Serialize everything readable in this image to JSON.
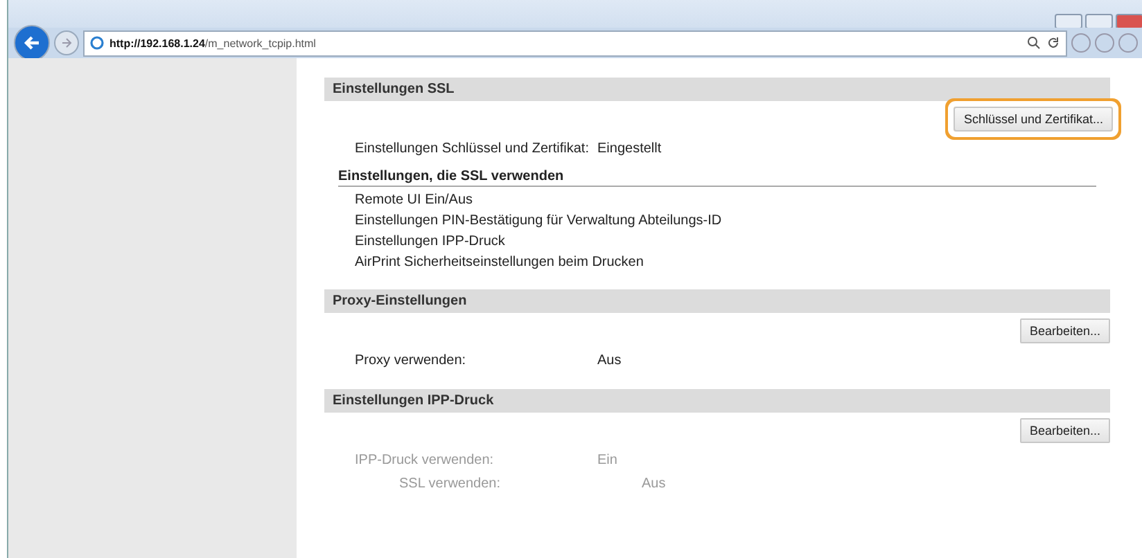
{
  "browser": {
    "url_host": "http://192.168.1.24",
    "url_path": "/m_network_tcpip.html"
  },
  "sections": [
    {
      "title": "Einstellungen SSL",
      "button": {
        "label": "Schlüssel und Zertifikat...",
        "highlighted": true
      },
      "rows": [
        {
          "label": "Einstellungen Schlüssel und Zertifikat:",
          "value": "Eingestellt",
          "indented": false
        }
      ],
      "subheading": "Einstellungen, die SSL verwenden",
      "list": [
        "Remote UI Ein/Aus",
        "Einstellungen PIN-Bestätigung für Verwaltung Abteilungs-ID",
        "Einstellungen IPP-Druck",
        "AirPrint Sicherheitseinstellungen beim Drucken"
      ]
    },
    {
      "title": "Proxy-Einstellungen",
      "button": {
        "label": "Bearbeiten...",
        "highlighted": false
      },
      "rows": [
        {
          "label": "Proxy verwenden:",
          "value": "Aus",
          "indented": false
        }
      ]
    },
    {
      "title": "Einstellungen IPP-Druck",
      "button": {
        "label": "Bearbeiten...",
        "highlighted": false
      },
      "rows": [
        {
          "label": "IPP-Druck verwenden:",
          "value": "Ein",
          "indented": false
        },
        {
          "label": "SSL verwenden:",
          "value": "Aus",
          "indented": true
        }
      ]
    }
  ]
}
